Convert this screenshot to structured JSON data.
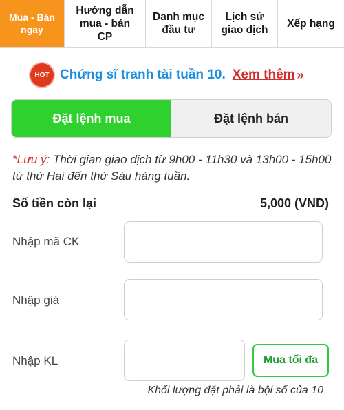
{
  "tabs": [
    {
      "label": "Mua - Bán\nngay",
      "active": true
    },
    {
      "label": "Hướng dẫn\nmua - bán\nCP",
      "active": false
    },
    {
      "label": "Danh mục\nđầu tư",
      "active": false
    },
    {
      "label": "Lịch sử\ngiao dịch",
      "active": false
    },
    {
      "label": "Xếp hạng",
      "active": false
    }
  ],
  "announcement": {
    "badge": "HOT",
    "text": "Chứng sĩ tranh tài tuần 10.",
    "link": "Xem thêm",
    "link_icon": "double-chevron-right-icon"
  },
  "order_toggle": {
    "buy_label": "Đặt lệnh mua",
    "sell_label": "Đặt lệnh bán",
    "selected": "buy"
  },
  "note": {
    "label": "*Lưu ý:",
    "text": " Thời gian giao dịch từ 9h00 - 11h30 và 13h00 - 15h00 từ thứ Hai đến thứ Sáu hàng tuần."
  },
  "balance": {
    "label": "Số tiền còn lại",
    "value": "5,000 (VND)"
  },
  "form": {
    "symbol_label": "Nhập mã CK",
    "symbol_value": "",
    "price_label": "Nhập giá",
    "price_value": "",
    "quantity_label": "Nhập KL",
    "quantity_value": "",
    "max_button": "Mua tối đa",
    "quantity_hint": "Khối lượng đặt phải là bội số của 10"
  },
  "colors": {
    "active_tab": "#f7941d",
    "buy": "#2ed12e",
    "link": "#1b8fe0",
    "alert": "#d32f2f"
  }
}
